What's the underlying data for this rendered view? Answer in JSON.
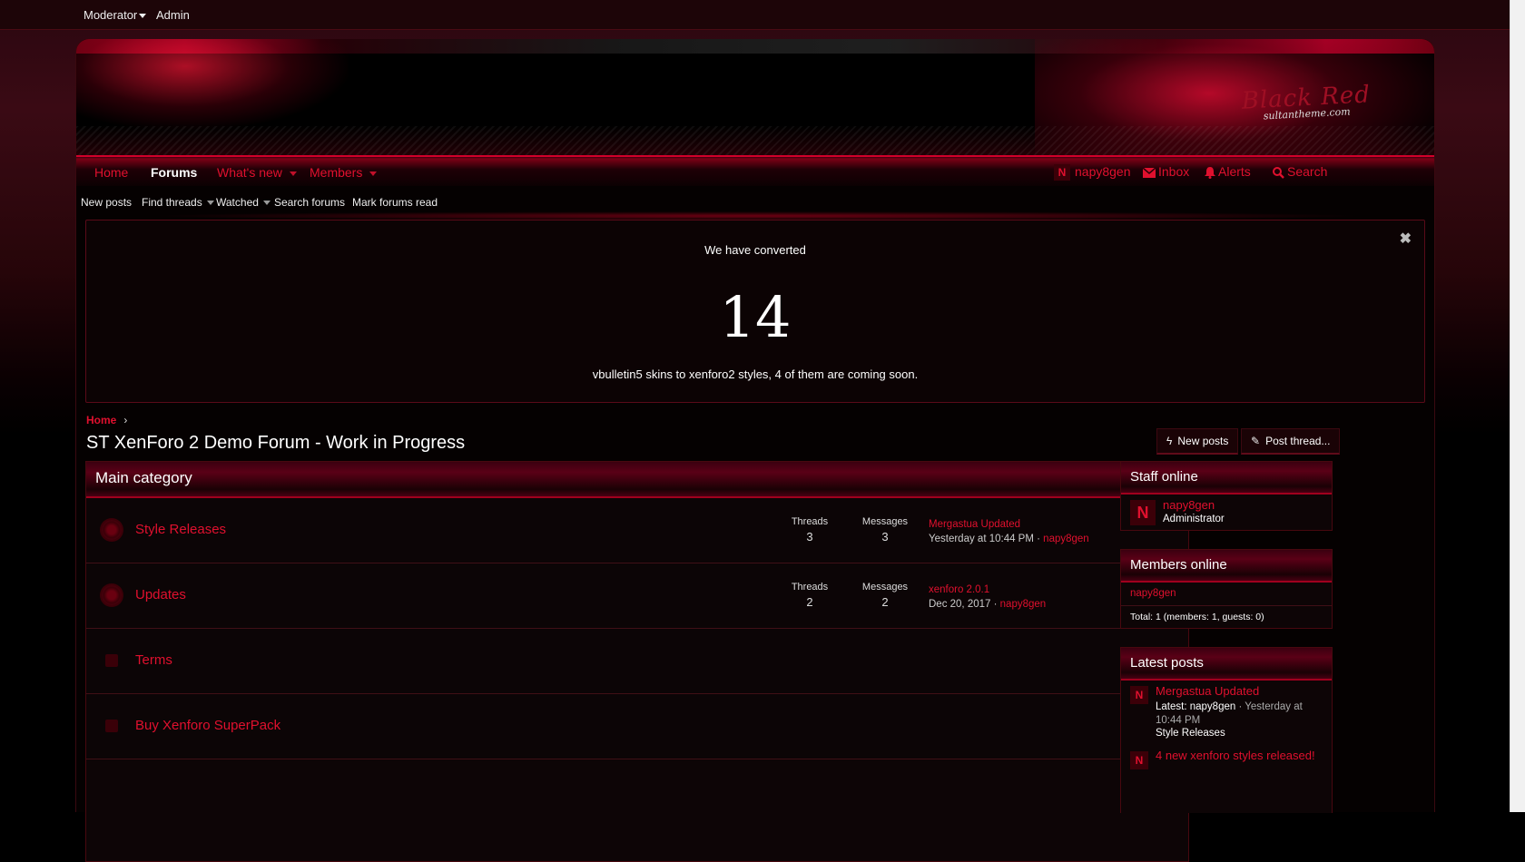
{
  "staff_bar": {
    "moderator": "Moderator",
    "admin": "Admin"
  },
  "logo": {
    "line1": "Black Red",
    "line2": "sultantheme.com"
  },
  "nav": {
    "tabs": [
      "Home",
      "Forums",
      "What's new",
      "Members"
    ],
    "active_tab": "Forums",
    "user": {
      "initial": "N",
      "name": "napy8gen"
    },
    "inbox": "Inbox",
    "alerts": "Alerts",
    "search": "Search"
  },
  "subnav": [
    "New posts",
    "Find threads",
    "Watched",
    "Search forums",
    "Mark forums read"
  ],
  "notice": {
    "line1": "We have converted",
    "number": "14",
    "line2": "vbulletin5 skins to xenforo2 styles, 4 of them are coming soon.",
    "close": "✖"
  },
  "breadcrumb": {
    "home": "Home",
    "sep": "›"
  },
  "page_title": "ST XenForo 2 Demo Forum - Work in Progress",
  "buttons": {
    "new_posts": "New posts",
    "post_thread": "Post thread..."
  },
  "category": {
    "title": "Main category",
    "nodes": [
      {
        "title": "Style Releases",
        "threads_label": "Threads",
        "threads": "3",
        "messages_label": "Messages",
        "messages": "3",
        "latest_title": "Mergastua Updated",
        "latest_date": "Yesterday at 10:44 PM",
        "latest_user": "napy8gen"
      },
      {
        "title": "Updates",
        "threads_label": "Threads",
        "threads": "2",
        "messages_label": "Messages",
        "messages": "2",
        "latest_title": "xenforo 2.0.1",
        "latest_date": "Dec 20, 2017",
        "latest_user": "napy8gen"
      },
      {
        "title": "Terms"
      },
      {
        "title": "Buy Xenforo SuperPack"
      }
    ]
  },
  "sidebar": {
    "staff": {
      "title": "Staff online",
      "initial": "N",
      "name": "napy8gen",
      "role": "Administrator"
    },
    "members": {
      "title": "Members online",
      "name": "napy8gen",
      "total": "Total: 1 (members: 1, guests: 0)"
    },
    "latest": {
      "title": "Latest posts",
      "posts": [
        {
          "initial": "N",
          "title": "Mergastua Updated",
          "latest_label": "Latest:",
          "user": "napy8gen",
          "date": "Yesterday at 10:44 PM",
          "forum": "Style Releases"
        },
        {
          "initial": "N",
          "title": "4 new xenforo styles released!"
        }
      ]
    }
  },
  "colors": {
    "accent": "#e0102e",
    "header_border": "#a0001e",
    "background": "#000000"
  }
}
